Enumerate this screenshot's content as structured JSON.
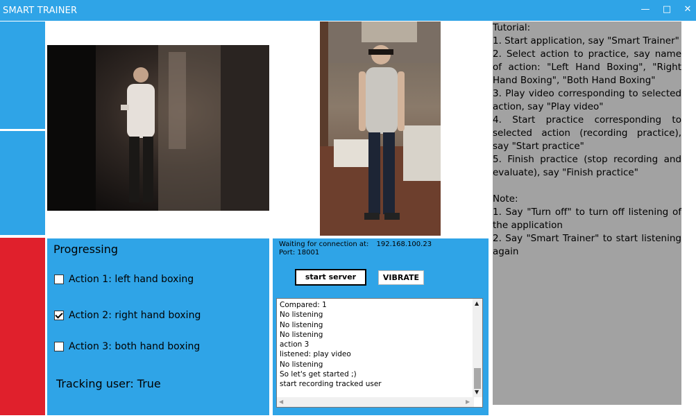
{
  "window": {
    "title": "SMART TRAINER",
    "controls": [
      "minimize-icon",
      "maximize-icon",
      "close-icon"
    ]
  },
  "colors": {
    "accent": "#2fa4e7",
    "red_tile": "#e0202c",
    "tutorial_bg": "#a2a2a2"
  },
  "tutorial": {
    "lines": [
      "Tutorial:",
      "1. Start application, say \"Smart Trainer\"",
      "2. Select action to practice, say name of action: \"Left Hand Boxing\", \"Right Hand Boxing\", \"Both Hand Boxing\"",
      "3. Play video corresponding to selected action, say \"Play video\"",
      "4. Start practice corresponding to selected action (recording practice), say \"Start practice\"",
      "5. Finish practice (stop recording and evaluate), say \"Finish practice\"",
      "",
      "Note:",
      "1. Say \"Turn off\" to turn off listening of the application",
      "2. Say \"Smart Trainer\" to start listening again"
    ]
  },
  "progress": {
    "title": "Progressing",
    "actions": [
      {
        "label": "Action 1: left hand boxing",
        "checked": false
      },
      {
        "label": "Action 2: right hand boxing",
        "checked": true
      },
      {
        "label": "Action 3: both hand boxing",
        "checked": false
      }
    ],
    "tracking": "Tracking user: True"
  },
  "server": {
    "waiting_label": "Waiting for connection at:",
    "ip": "192.168.100.23",
    "port_label": "Port: 18001",
    "start_button": "start server",
    "vibrate_button": "VIBRATE",
    "log": [
      "Compared: 1",
      "No listening",
      "No listening",
      "No listening",
      "action 3",
      "listened: play video",
      "No listening",
      "So let's get started ;)",
      "start recording tracked user"
    ]
  }
}
